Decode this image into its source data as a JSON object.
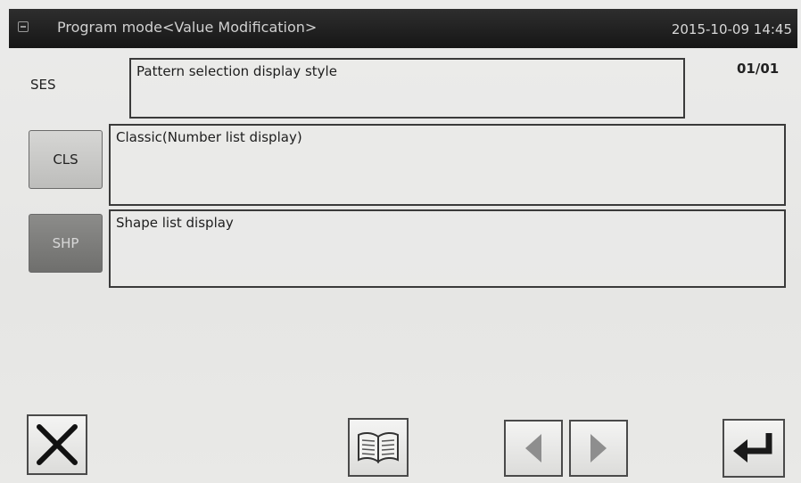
{
  "header": {
    "title": "Program mode<Value Modification>",
    "datetime": "2015-10-09 14:45"
  },
  "setting": {
    "code": "SES",
    "description": "Pattern selection display style",
    "page": "01/01"
  },
  "options": [
    {
      "code": "CLS",
      "description": "Classic(Number list display)",
      "selected": false
    },
    {
      "code": "SHP",
      "description": "Shape list display",
      "selected": true
    }
  ],
  "footer": {
    "icons": [
      "close-icon",
      "book-icon",
      "arrow-left-icon",
      "arrow-right-icon",
      "enter-icon"
    ]
  },
  "colors": {
    "title_bar": "#1e1e1e",
    "selected_button": "#7d7d7b",
    "normal_button": "#c9c9c7",
    "enter_arrow": "#1a1a1a",
    "arrow_disabled": "#8e8e8e"
  }
}
